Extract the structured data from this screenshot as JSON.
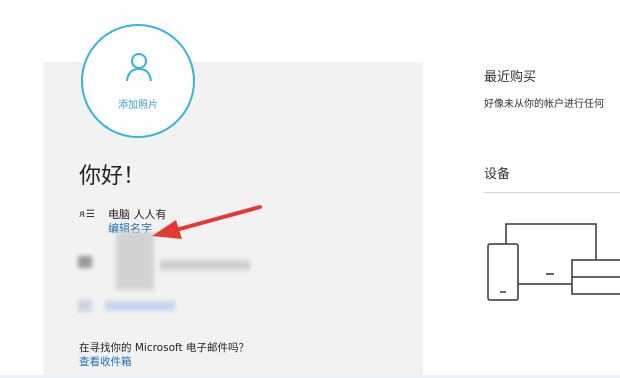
{
  "profile": {
    "add_photo_label": "添加照片",
    "greeting": "你好！",
    "name_icon": "ᴙ☰",
    "name": "电脑 人人有",
    "edit_name_link": "编辑名字",
    "email_prompt": "在寻找你的 Microsoft 电子邮件吗？",
    "view_inbox_link": "查看收件箱"
  },
  "recent_purchases": {
    "title": "最近购买",
    "description": "好像未从你的帐户进行任何"
  },
  "devices": {
    "title": "设备"
  },
  "colors": {
    "accent": "#35b5d9",
    "link": "#1a6fb5",
    "annotation_arrow": "#e53935"
  }
}
